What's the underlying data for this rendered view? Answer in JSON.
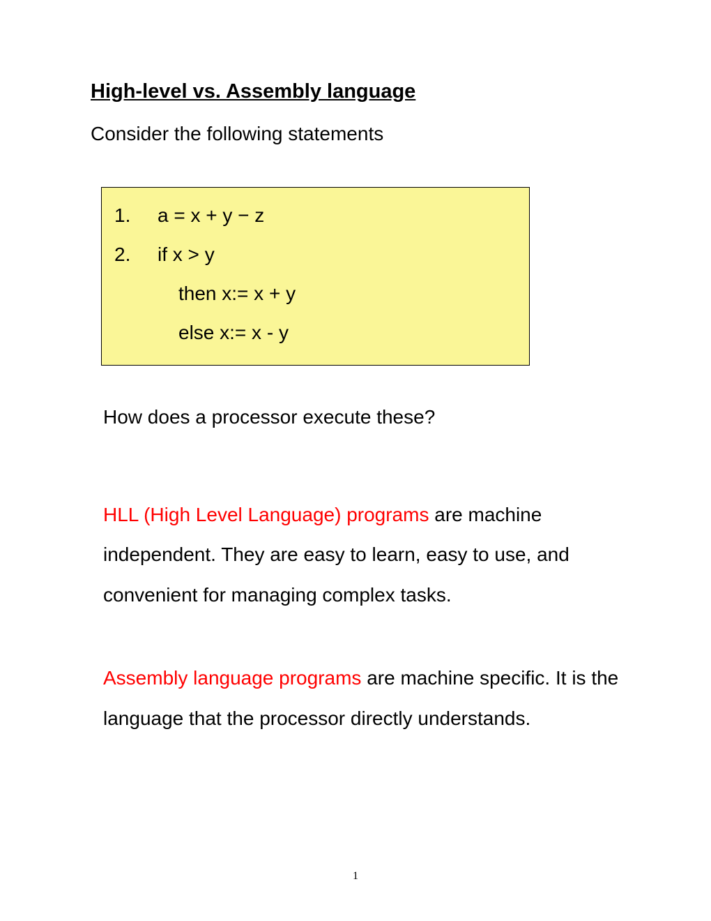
{
  "title": "High-level vs. Assembly language",
  "intro": "Consider the following statements",
  "code": {
    "line1_num": "1.",
    "line1_text": "a = x + y − z",
    "line2_num": "2.",
    "line2_text": "if x > y",
    "line3_text": "then x:= x + y",
    "line4_text": "else x:= x - y"
  },
  "question": "How does a processor execute these?",
  "para1": {
    "highlight": "HLL (High Level Language) programs",
    "rest": " are machine independent. They are easy to learn, easy to use, and convenient for managing complex tasks."
  },
  "para2": {
    "highlight": "Assembly language programs",
    "rest": " are machine specific. It is the language that the processor directly understands."
  },
  "pageNumber": "1"
}
